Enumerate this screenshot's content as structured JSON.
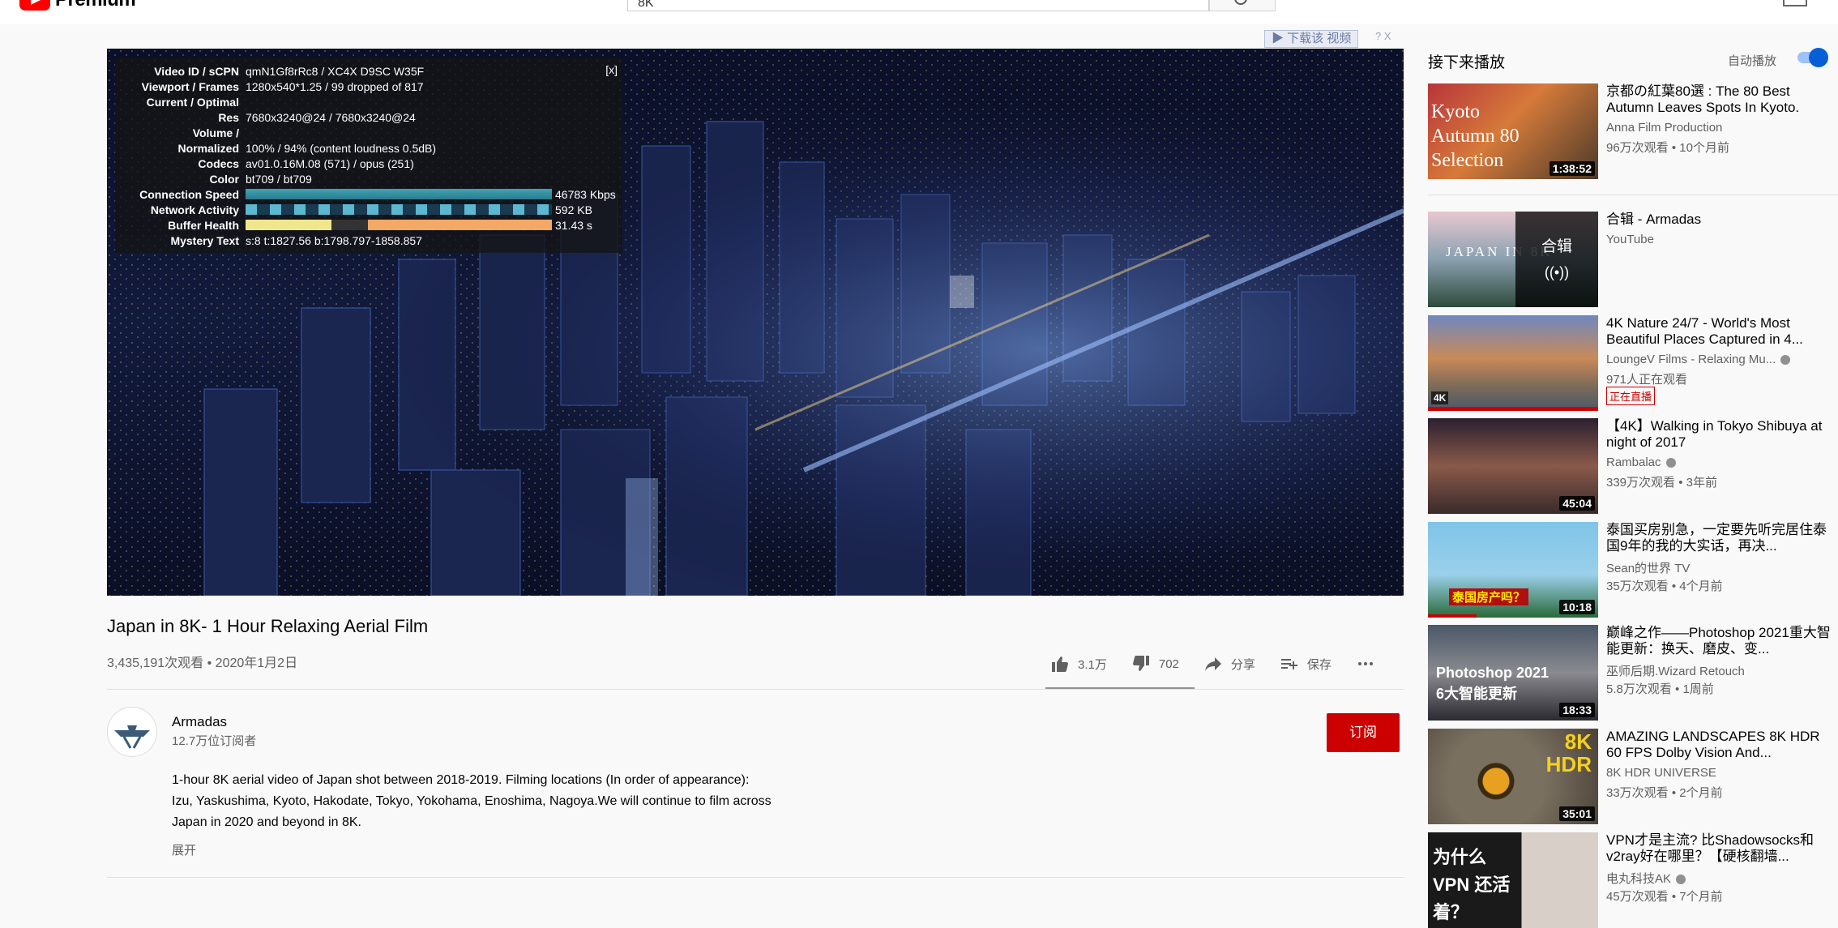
{
  "header": {
    "logo_text": "Premium",
    "search_value": "8K"
  },
  "download": {
    "label": "下载该 视频",
    "help": "? X"
  },
  "stats": {
    "close": "[x]",
    "rows": [
      {
        "k": "Video ID / sCPN",
        "v": "qmN1Gf8rRc8 / XC4X D9SC W35F"
      },
      {
        "k": "Viewport / Frames",
        "v": "1280x540*1.25 / 99 dropped of 817"
      },
      {
        "k": "Current / Optimal",
        "v": ""
      },
      {
        "k": "Res",
        "v": "7680x3240@24 / 7680x3240@24"
      },
      {
        "k": "Volume /",
        "v": ""
      },
      {
        "k": "Normalized",
        "v": "100% / 94% (content loudness 0.5dB)"
      },
      {
        "k": "Codecs",
        "v": "av01.0.16M.08 (571) / opus (251)"
      },
      {
        "k": "Color",
        "v": "bt709 / bt709"
      },
      {
        "k": "Connection Speed",
        "v": "46783 Kbps"
      },
      {
        "k": "Network Activity",
        "v": "592 KB"
      },
      {
        "k": "Buffer Health",
        "v": "31.43 s"
      },
      {
        "k": "Mystery Text",
        "v": "s:8 t:1827.56 b:1798.797-1858.857"
      }
    ]
  },
  "video": {
    "title": "Japan in 8K- 1 Hour Relaxing Aerial Film",
    "views": "3,435,191次观看 • 2020年1月2日",
    "likes": "3.1万",
    "dislikes": "702",
    "share": "分享",
    "save": "保存"
  },
  "channel": {
    "name": "Armadas",
    "subs": "12.7万位订阅者",
    "subscribe": "订阅"
  },
  "description": {
    "text": "1-hour 8K aerial video of Japan shot between 2018-2019. Filming locations (In order of appearance): Izu, Yaskushima, Kyoto, Hakodate, Tokyo, Yokohama, Enoshima, Nagoya.We will continue to film across Japan in 2020 and beyond in 8K.",
    "expand": "展开"
  },
  "sidebar": {
    "upnext": "接下来播放",
    "autoplay": "自动播放",
    "items": [
      {
        "title": "京都の紅葉80選 : The 80 Best Autumn Leaves Spots In Kyoto.",
        "channel": "Anna Film Production",
        "meta": "96万次观看 • 10个月前",
        "duration": "1:38:52",
        "thumb_text": "Kyoto Autumn 80 Selection"
      },
      {
        "title": "合辑 - Armadas",
        "channel": "YouTube",
        "meta": "",
        "duration": "",
        "thumb_text": "JAPAN IN 8K",
        "overlay_text": "合辑"
      },
      {
        "title": "4K Nature 24/7 - World's Most Beautiful Places Captured in 4...",
        "channel": "LoungeV Films - Relaxing Mu...",
        "meta": "971人正在观看",
        "duration": "",
        "live": "正在直播",
        "thumb_text": "4K"
      },
      {
        "title": "【4K】Walking in Tokyo Shibuya at night of 2017",
        "channel": "Rambalac",
        "meta": "339万次观看 • 3年前",
        "duration": "45:04"
      },
      {
        "title": "泰国买房别急，一定要先听完居住泰国9年的我的大实话，再决...",
        "channel": "Sean的世界 TV",
        "meta": "35万次观看 • 4个月前",
        "duration": "10:18",
        "thumb_text": "泰国房产吗？"
      },
      {
        "title": "巅峰之作——Photoshop 2021重大智能更新：换天、磨皮、变...",
        "channel": "巫师后期.Wizard Retouch",
        "meta": "5.8万次观看 • 1周前",
        "duration": "18:33",
        "thumb_text": "Photoshop 2021 6大智能更新"
      },
      {
        "title": "AMAZING LANDSCAPES 8K HDR 60 FPS Dolby Vision And...",
        "channel": "8K HDR UNIVERSE",
        "meta": "33万次观看 • 2个月前",
        "duration": "35:01",
        "thumb_text": "8K HDR"
      },
      {
        "title": "VPN才是主流? 比Shadowsocks和v2ray好在哪里？【硬核翻墙...",
        "channel": "电丸科技AK",
        "meta": "45万次观看 • 7个月前",
        "duration": "",
        "thumb_text": "为什么VPN 还活着？"
      }
    ]
  }
}
